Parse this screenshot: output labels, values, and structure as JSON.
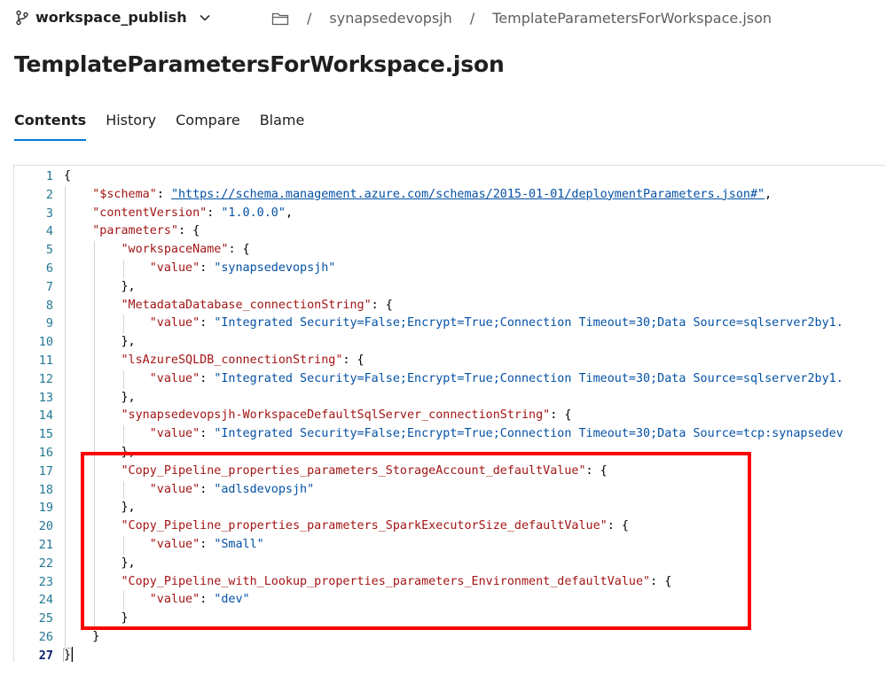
{
  "header": {
    "branch": "workspace_publish",
    "breadcrumb": {
      "separator": "/",
      "repo": "synapsedevopsjh",
      "file": "TemplateParametersForWorkspace.json"
    }
  },
  "page_title": "TemplateParametersForWorkspace.json",
  "tabs": [
    {
      "label": "Contents",
      "active": true
    },
    {
      "label": "History",
      "active": false
    },
    {
      "label": "Compare",
      "active": false
    },
    {
      "label": "Blame",
      "active": false
    }
  ],
  "editor": {
    "current_line": 27,
    "highlight_lines": [
      17,
      25
    ],
    "lines": [
      {
        "n": 1,
        "indent": 0,
        "parts": [
          [
            "p",
            "{"
          ]
        ]
      },
      {
        "n": 2,
        "indent": 1,
        "parts": [
          [
            "k",
            "\"$schema\""
          ],
          [
            "p",
            ": "
          ],
          [
            "u",
            "\"https://schema.management.azure.com/schemas/2015-01-01/deploymentParameters.json#\""
          ],
          [
            "p",
            ","
          ]
        ]
      },
      {
        "n": 3,
        "indent": 1,
        "parts": [
          [
            "k",
            "\"contentVersion\""
          ],
          [
            "p",
            ": "
          ],
          [
            "s",
            "\"1.0.0.0\""
          ],
          [
            "p",
            ","
          ]
        ]
      },
      {
        "n": 4,
        "indent": 1,
        "parts": [
          [
            "k",
            "\"parameters\""
          ],
          [
            "p",
            ": {"
          ]
        ]
      },
      {
        "n": 5,
        "indent": 2,
        "parts": [
          [
            "k",
            "\"workspaceName\""
          ],
          [
            "p",
            ": {"
          ]
        ]
      },
      {
        "n": 6,
        "indent": 3,
        "parts": [
          [
            "k",
            "\"value\""
          ],
          [
            "p",
            ": "
          ],
          [
            "s",
            "\"synapsedevopsjh\""
          ]
        ]
      },
      {
        "n": 7,
        "indent": 2,
        "parts": [
          [
            "p",
            "},"
          ]
        ]
      },
      {
        "n": 8,
        "indent": 2,
        "parts": [
          [
            "k",
            "\"MetadataDatabase_connectionString\""
          ],
          [
            "p",
            ": {"
          ]
        ]
      },
      {
        "n": 9,
        "indent": 3,
        "parts": [
          [
            "k",
            "\"value\""
          ],
          [
            "p",
            ": "
          ],
          [
            "s",
            "\"Integrated Security=False;Encrypt=True;Connection Timeout=30;Data Source=sqlserver2by1."
          ]
        ]
      },
      {
        "n": 10,
        "indent": 2,
        "parts": [
          [
            "p",
            "},"
          ]
        ]
      },
      {
        "n": 11,
        "indent": 2,
        "parts": [
          [
            "k",
            "\"lsAzureSQLDB_connectionString\""
          ],
          [
            "p",
            ": {"
          ]
        ]
      },
      {
        "n": 12,
        "indent": 3,
        "parts": [
          [
            "k",
            "\"value\""
          ],
          [
            "p",
            ": "
          ],
          [
            "s",
            "\"Integrated Security=False;Encrypt=True;Connection Timeout=30;Data Source=sqlserver2by1."
          ]
        ]
      },
      {
        "n": 13,
        "indent": 2,
        "parts": [
          [
            "p",
            "},"
          ]
        ]
      },
      {
        "n": 14,
        "indent": 2,
        "parts": [
          [
            "k",
            "\"synapsedevopsjh-WorkspaceDefaultSqlServer_connectionString\""
          ],
          [
            "p",
            ": {"
          ]
        ]
      },
      {
        "n": 15,
        "indent": 3,
        "parts": [
          [
            "k",
            "\"value\""
          ],
          [
            "p",
            ": "
          ],
          [
            "s",
            "\"Integrated Security=False;Encrypt=True;Connection Timeout=30;Data Source=tcp:synapsedev"
          ]
        ]
      },
      {
        "n": 16,
        "indent": 2,
        "parts": [
          [
            "p",
            "},"
          ]
        ]
      },
      {
        "n": 17,
        "indent": 2,
        "parts": [
          [
            "k",
            "\"Copy_Pipeline_properties_parameters_StorageAccount_defaultValue\""
          ],
          [
            "p",
            ": {"
          ]
        ]
      },
      {
        "n": 18,
        "indent": 3,
        "parts": [
          [
            "k",
            "\"value\""
          ],
          [
            "p",
            ": "
          ],
          [
            "s",
            "\"adlsdevopsjh\""
          ]
        ]
      },
      {
        "n": 19,
        "indent": 2,
        "parts": [
          [
            "p",
            "},"
          ]
        ]
      },
      {
        "n": 20,
        "indent": 2,
        "parts": [
          [
            "k",
            "\"Copy_Pipeline_properties_parameters_SparkExecutorSize_defaultValue\""
          ],
          [
            "p",
            ": {"
          ]
        ]
      },
      {
        "n": 21,
        "indent": 3,
        "parts": [
          [
            "k",
            "\"value\""
          ],
          [
            "p",
            ": "
          ],
          [
            "s",
            "\"Small\""
          ]
        ]
      },
      {
        "n": 22,
        "indent": 2,
        "parts": [
          [
            "p",
            "},"
          ]
        ]
      },
      {
        "n": 23,
        "indent": 2,
        "parts": [
          [
            "k",
            "\"Copy_Pipeline_with_Lookup_properties_parameters_Environment_defaultValue\""
          ],
          [
            "p",
            ": {"
          ]
        ]
      },
      {
        "n": 24,
        "indent": 3,
        "parts": [
          [
            "k",
            "\"value\""
          ],
          [
            "p",
            ": "
          ],
          [
            "s",
            "\"dev\""
          ]
        ]
      },
      {
        "n": 25,
        "indent": 2,
        "parts": [
          [
            "p",
            "}"
          ]
        ]
      },
      {
        "n": 26,
        "indent": 1,
        "parts": [
          [
            "p",
            "}"
          ]
        ]
      },
      {
        "n": 27,
        "indent": 0,
        "parts": [
          [
            "p",
            "}"
          ]
        ]
      }
    ]
  }
}
